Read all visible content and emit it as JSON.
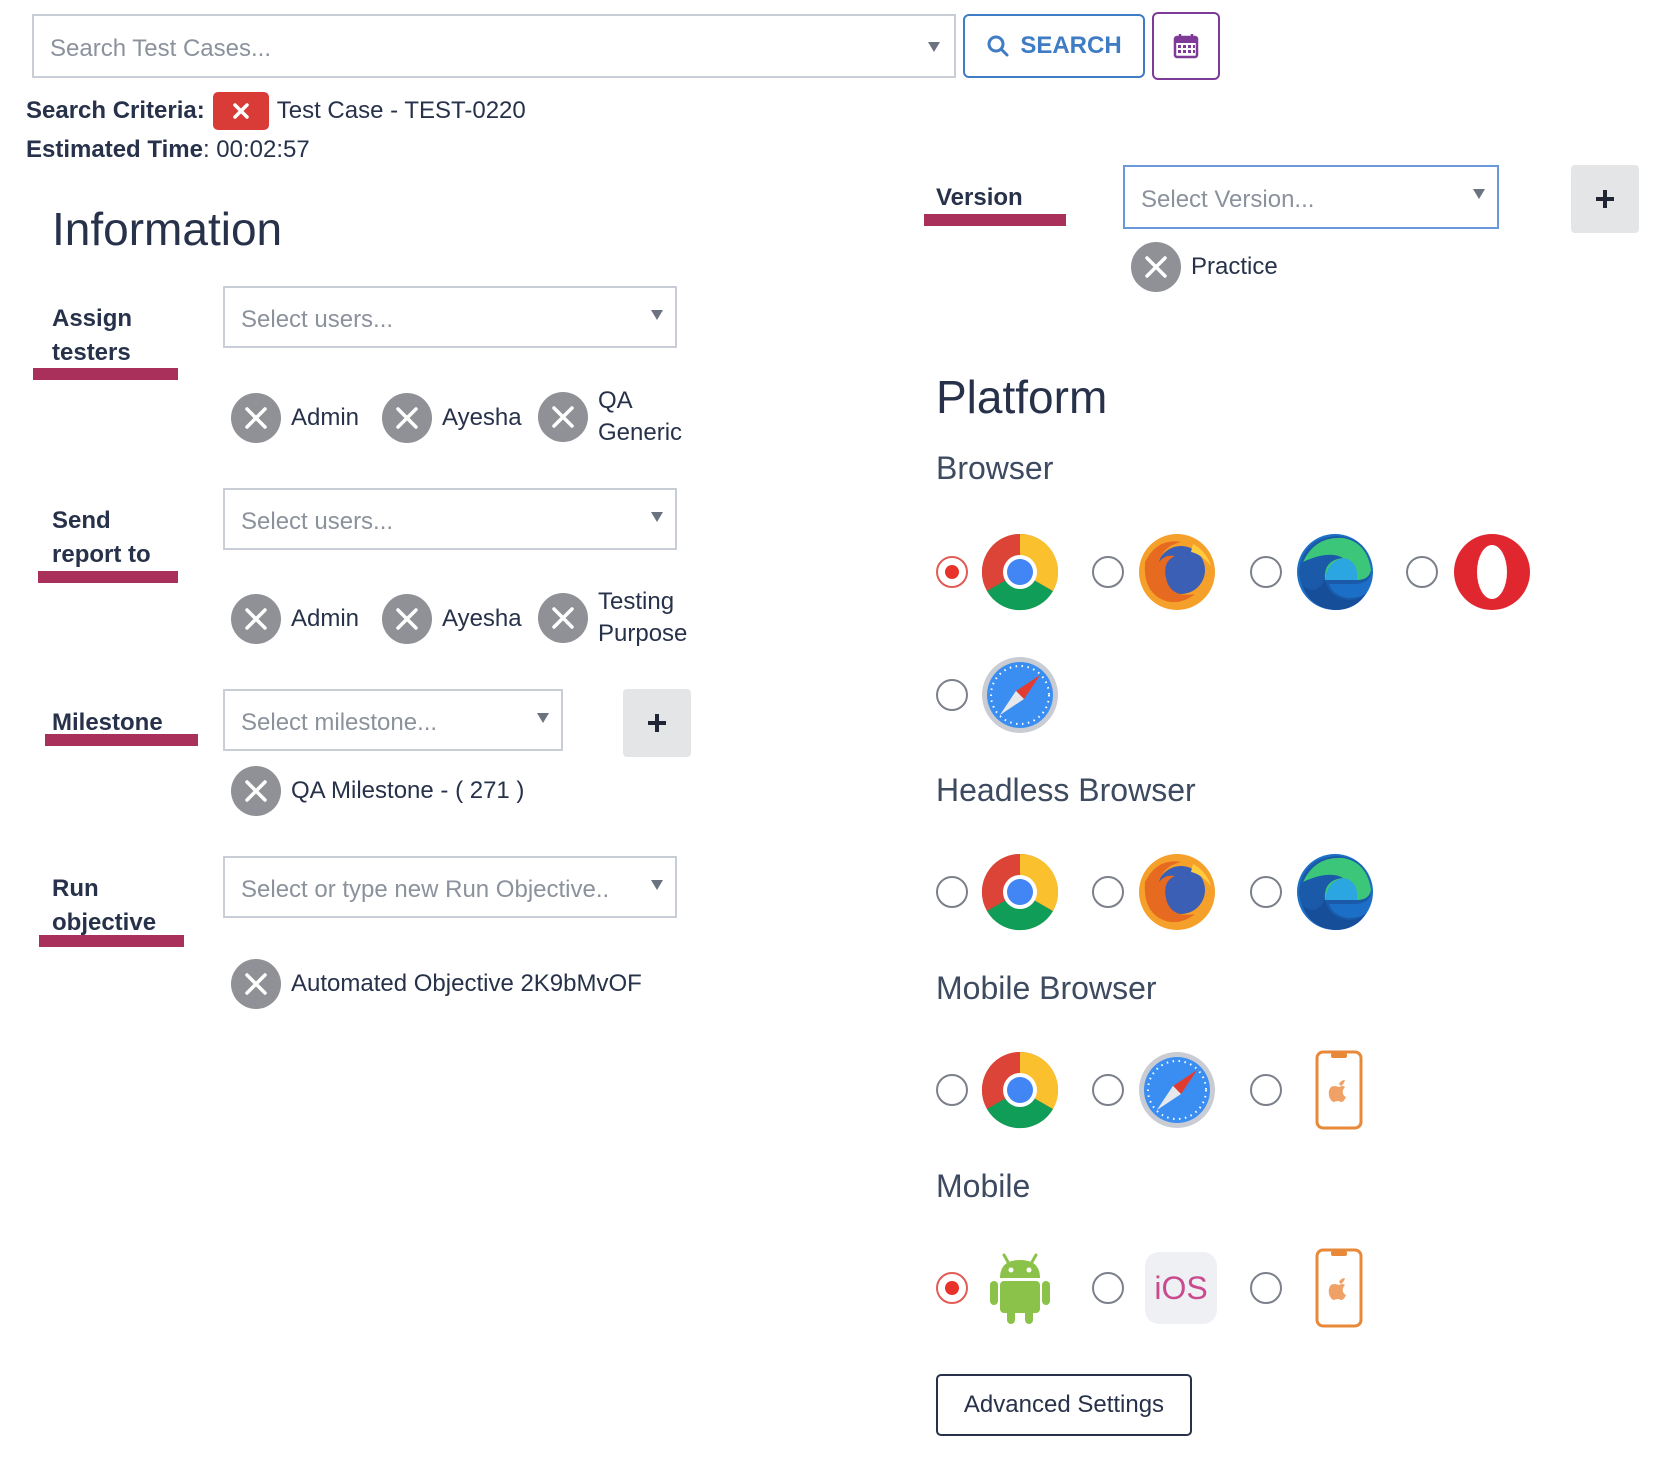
{
  "search": {
    "placeholder": "Search Test Cases...",
    "button_label": "SEARCH",
    "criteria_label": "Search Criteria:",
    "criteria_value": "Test Case - TEST-0220",
    "estimated_label": "Estimated Time",
    "estimated_value": ": 00:02:57"
  },
  "information": {
    "title": "Information",
    "assign_testers": {
      "label_line1": "Assign",
      "label_line2": "testers",
      "placeholder": "Select users...",
      "chips": [
        "Admin",
        "Ayesha",
        "QA",
        "Generic"
      ]
    },
    "send_report": {
      "label_line1": "Send",
      "label_line2": "report to",
      "placeholder": "Select users...",
      "chips": [
        "Admin",
        "Ayesha",
        "Testing",
        "Purpose"
      ]
    },
    "milestone": {
      "label": "Milestone",
      "placeholder": "Select milestone...",
      "chip": "QA Milestone - ( 271 )"
    },
    "run_objective": {
      "label_line1": "Run",
      "label_line2": "objective",
      "placeholder": "Select or type new Run Objective..",
      "chip": "Automated Objective 2K9bMvOF"
    }
  },
  "version": {
    "label": "Version",
    "placeholder": "Select Version...",
    "chip": "Practice"
  },
  "platform": {
    "title": "Platform",
    "browser": {
      "title": "Browser",
      "options": [
        "chrome-icon",
        "firefox-icon",
        "edge-icon",
        "opera-icon",
        "safari-icon"
      ],
      "selected": "chrome-icon"
    },
    "headless": {
      "title": "Headless Browser",
      "options": [
        "chrome-icon",
        "firefox-icon",
        "edge-icon"
      ],
      "selected": ""
    },
    "mobile_browser": {
      "title": "Mobile Browser",
      "options": [
        "chrome-icon",
        "safari-icon",
        "iphone-icon"
      ],
      "selected": ""
    },
    "mobile": {
      "title": "Mobile",
      "options": [
        "android-icon",
        "ios-icon",
        "iphone-icon"
      ],
      "selected": "android-icon",
      "ios_text": "iOS"
    }
  },
  "advanced_settings_label": "Advanced Settings",
  "colors": {
    "accent_underline": "#a9305a",
    "search_blue": "#3f7cc4",
    "calendar_purple": "#7d3a96",
    "remove_red": "#d93b36",
    "radio_selected": "#e8332a"
  }
}
